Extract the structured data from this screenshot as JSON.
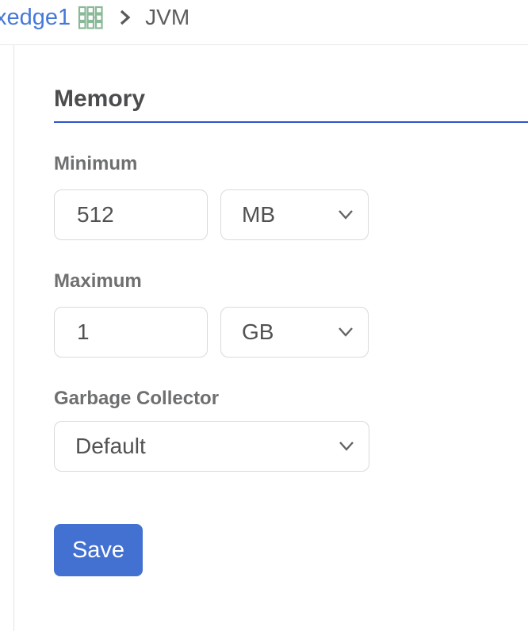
{
  "breadcrumb": {
    "parent_label": "xedge1",
    "current_label": "JVM"
  },
  "panel": {
    "section_title": "Memory",
    "fields": {
      "minimum": {
        "label": "Minimum",
        "value": "512",
        "unit": "MB"
      },
      "maximum": {
        "label": "Maximum",
        "value": "1",
        "unit": "GB"
      },
      "garbage_collector": {
        "label": "Garbage Collector",
        "selected": "Default"
      }
    },
    "save_button_label": "Save"
  },
  "icons": {
    "breadcrumb_node": "grid-icon",
    "breadcrumb_separator": "chevron-right-icon",
    "select_indicator": "chevron-down-icon"
  },
  "colors": {
    "breadcrumb_link_blue": "#4678d9",
    "grid_icon_green": "#8ab998",
    "section_rule_blue": "#2e55c9",
    "save_button_blue": "#4371d2",
    "input_border_gray": "#d9dadc",
    "label_gray": "#6e6f71"
  }
}
